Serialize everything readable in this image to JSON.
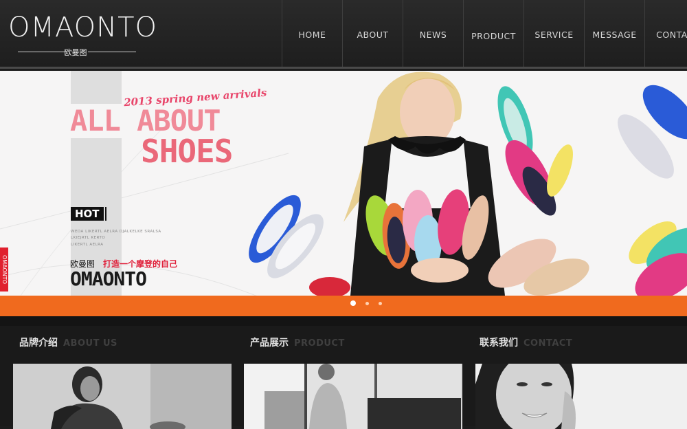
{
  "header": {
    "logo": "OMAONTO",
    "logo_sub": "欧曼图"
  },
  "nav": {
    "items": [
      {
        "label": "HOME"
      },
      {
        "label": "ABOUT"
      },
      {
        "label": "NEWS"
      },
      {
        "label": "PRODUCT"
      },
      {
        "label": "SERVICE"
      },
      {
        "label": "MESSAGE"
      },
      {
        "label": "CONTAC"
      }
    ]
  },
  "banner": {
    "tagline": "2013 spring new arrivals",
    "headline_line1": "ALL ABOUT",
    "headline_line2": "SHOES",
    "hot": "HOT",
    "small_text_1": "WEDA LIKERTL AELRA DJALKELKE SRALSA",
    "small_text_2": "LKIEJRTL KERTO",
    "small_text_3": "LIKERTL AELRA",
    "brand_cn": "欧曼图",
    "slogan_cn": "打造一个摩登的自己",
    "brand_big": "OMAONTO",
    "side_tab": "OMAONTO"
  },
  "slider": {
    "dots": 3,
    "active_index": 0
  },
  "sections": [
    {
      "title_cn": "品牌介绍",
      "title_en": "ABOUT US"
    },
    {
      "title_cn": "产品展示",
      "title_en": "PRODUCT"
    },
    {
      "title_cn": "联系我们",
      "title_en": "CONTACT"
    }
  ],
  "colors": {
    "accent_orange": "#f06a1e",
    "headline_pink": "#ea6879",
    "side_tab_red": "#e0202e"
  }
}
